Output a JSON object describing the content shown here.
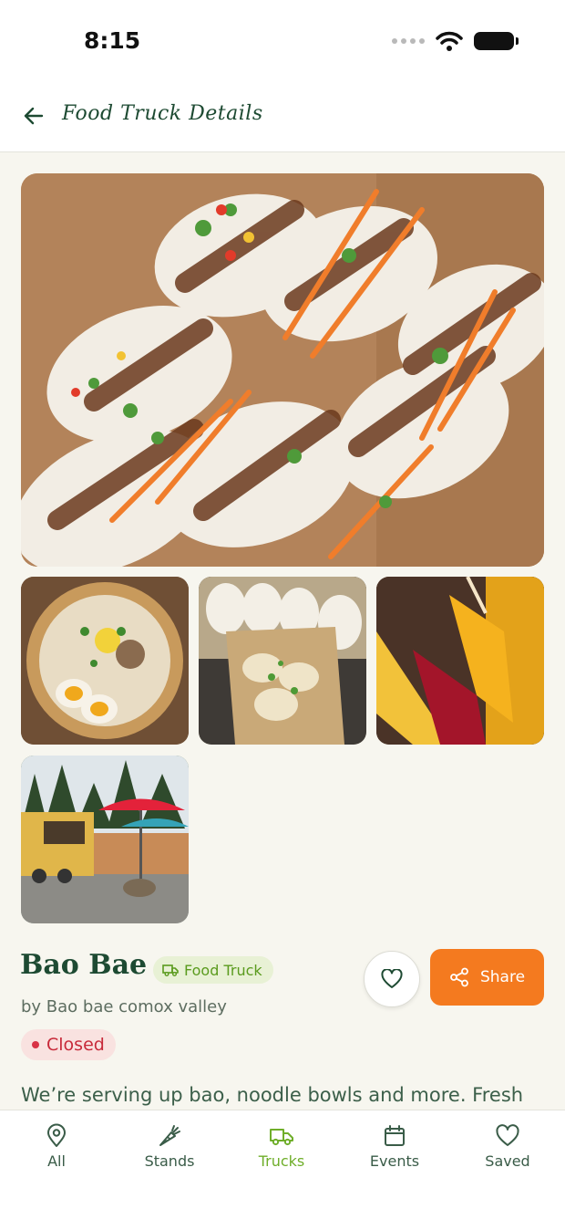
{
  "status_bar": {
    "time": "8:15"
  },
  "header": {
    "title": "Food Truck Details"
  },
  "truck": {
    "name": "Bao Bae",
    "type_badge": "Food Truck",
    "owner": "by Bao bae comox valley",
    "status": "Closed",
    "description": "We’re serving up bao, noodle bowls and more. Fresh"
  },
  "actions": {
    "share_label": "Share"
  },
  "tabs": [
    {
      "label": "All",
      "icon": "location-pin-icon"
    },
    {
      "label": "Stands",
      "icon": "carrot-icon"
    },
    {
      "label": "Trucks",
      "icon": "truck-icon"
    },
    {
      "label": "Events",
      "icon": "calendar-icon"
    },
    {
      "label": "Saved",
      "icon": "heart-icon"
    }
  ],
  "colors": {
    "primary_text": "#1d4a32",
    "accent_orange": "#f47a1f",
    "active_tab": "#6fae2a",
    "closed_red": "#c82a3a"
  }
}
